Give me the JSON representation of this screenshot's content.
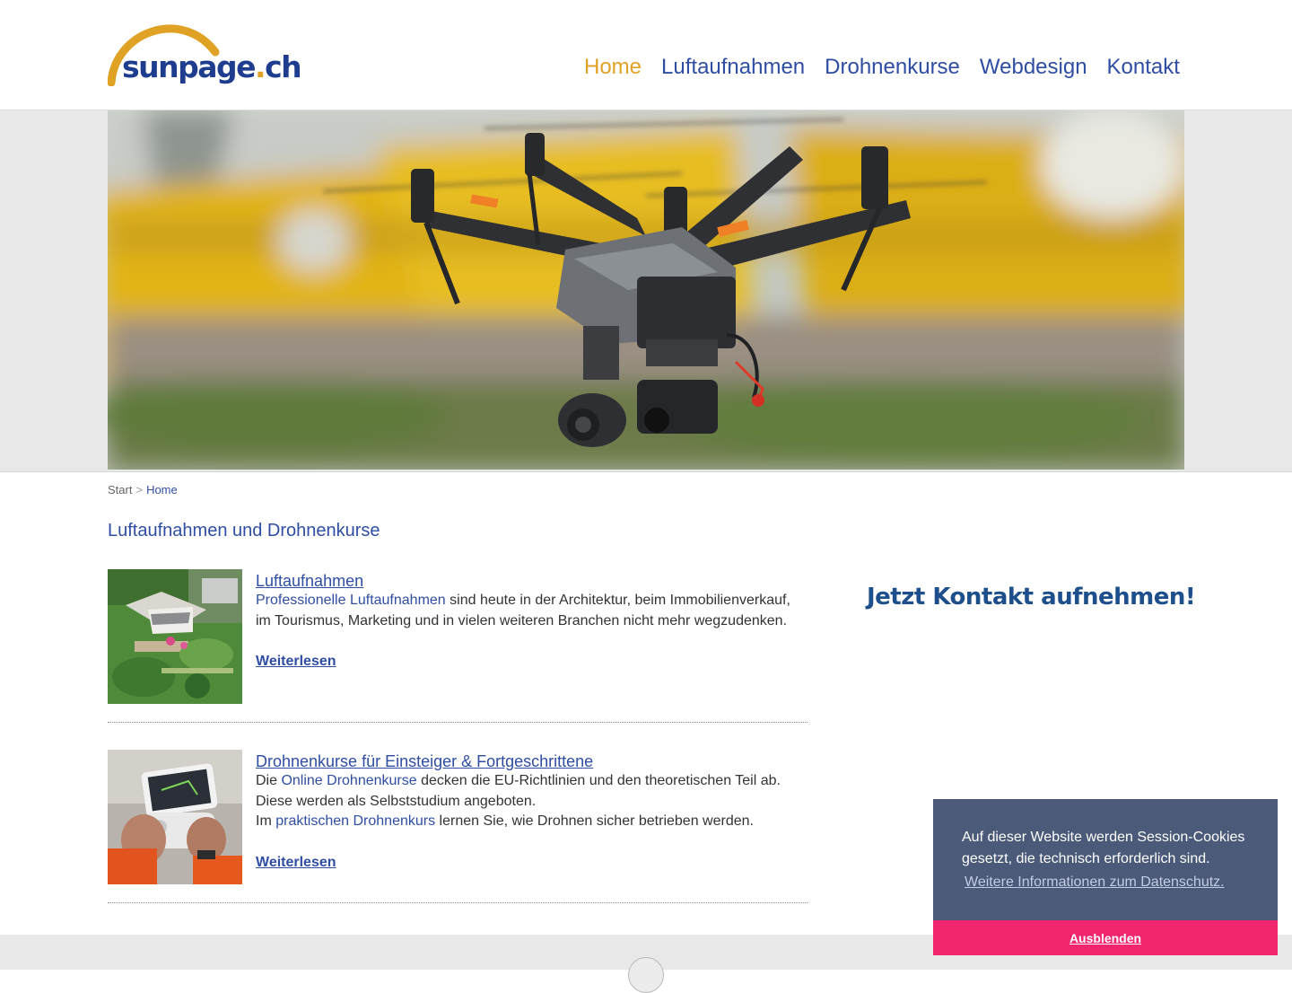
{
  "header": {
    "logo_text": "sunpage",
    "logo_dot": ".",
    "logo_tld": "ch",
    "nav": [
      {
        "label": "Home",
        "active": true
      },
      {
        "label": "Luftaufnahmen",
        "active": false
      },
      {
        "label": "Drohnenkurse",
        "active": false
      },
      {
        "label": "Webdesign",
        "active": false
      },
      {
        "label": "Kontakt",
        "active": false
      }
    ]
  },
  "breadcrumb": {
    "start": "Start",
    "separator": ">",
    "current": "Home"
  },
  "page_title": "Luftaufnahmen und Drohnenkurse",
  "articles": [
    {
      "title": "Luftaufnahmen",
      "link1": "Professionelle Luftaufnahmen",
      "text1": " sind heute in der Architektur, beim Immobilienverkauf, im Tourismus, Marketing und in vielen weiteren Branchen nicht mehr wegzudenken.",
      "more": "Weiterlesen"
    },
    {
      "title": "Drohnenkurse für Einsteiger & Fortgeschrittene",
      "text_pre": "Die ",
      "link1": "Online Drohnenkurse",
      "text1": " decken die EU-Richtlinien und den theoretischen Teil ab. Diese werden als Selbststudium angeboten.",
      "text2_pre": "Im ",
      "link2": "praktischen Drohnenkurs",
      "text2": " lernen Sie, wie Drohnen sicher betrieben werden.",
      "more": "Weiterlesen"
    }
  ],
  "cta": {
    "label": "Jetzt Kontakt aufnehmen!",
    "icon": "checkmark-circle-icon"
  },
  "cookie": {
    "message": "Auf dieser Website werden Session-Cookies gesetzt, die technisch erforderlich sind.",
    "link": "Weitere Informationen zum Datenschutz.",
    "button": "Ausblenden"
  },
  "colors": {
    "brand_blue": "#2f4ea3",
    "accent_gold": "#e0a225",
    "cookie_bg": "#4b5a78",
    "cookie_button": "#f1266f",
    "cta_green": "#2fae1f"
  }
}
